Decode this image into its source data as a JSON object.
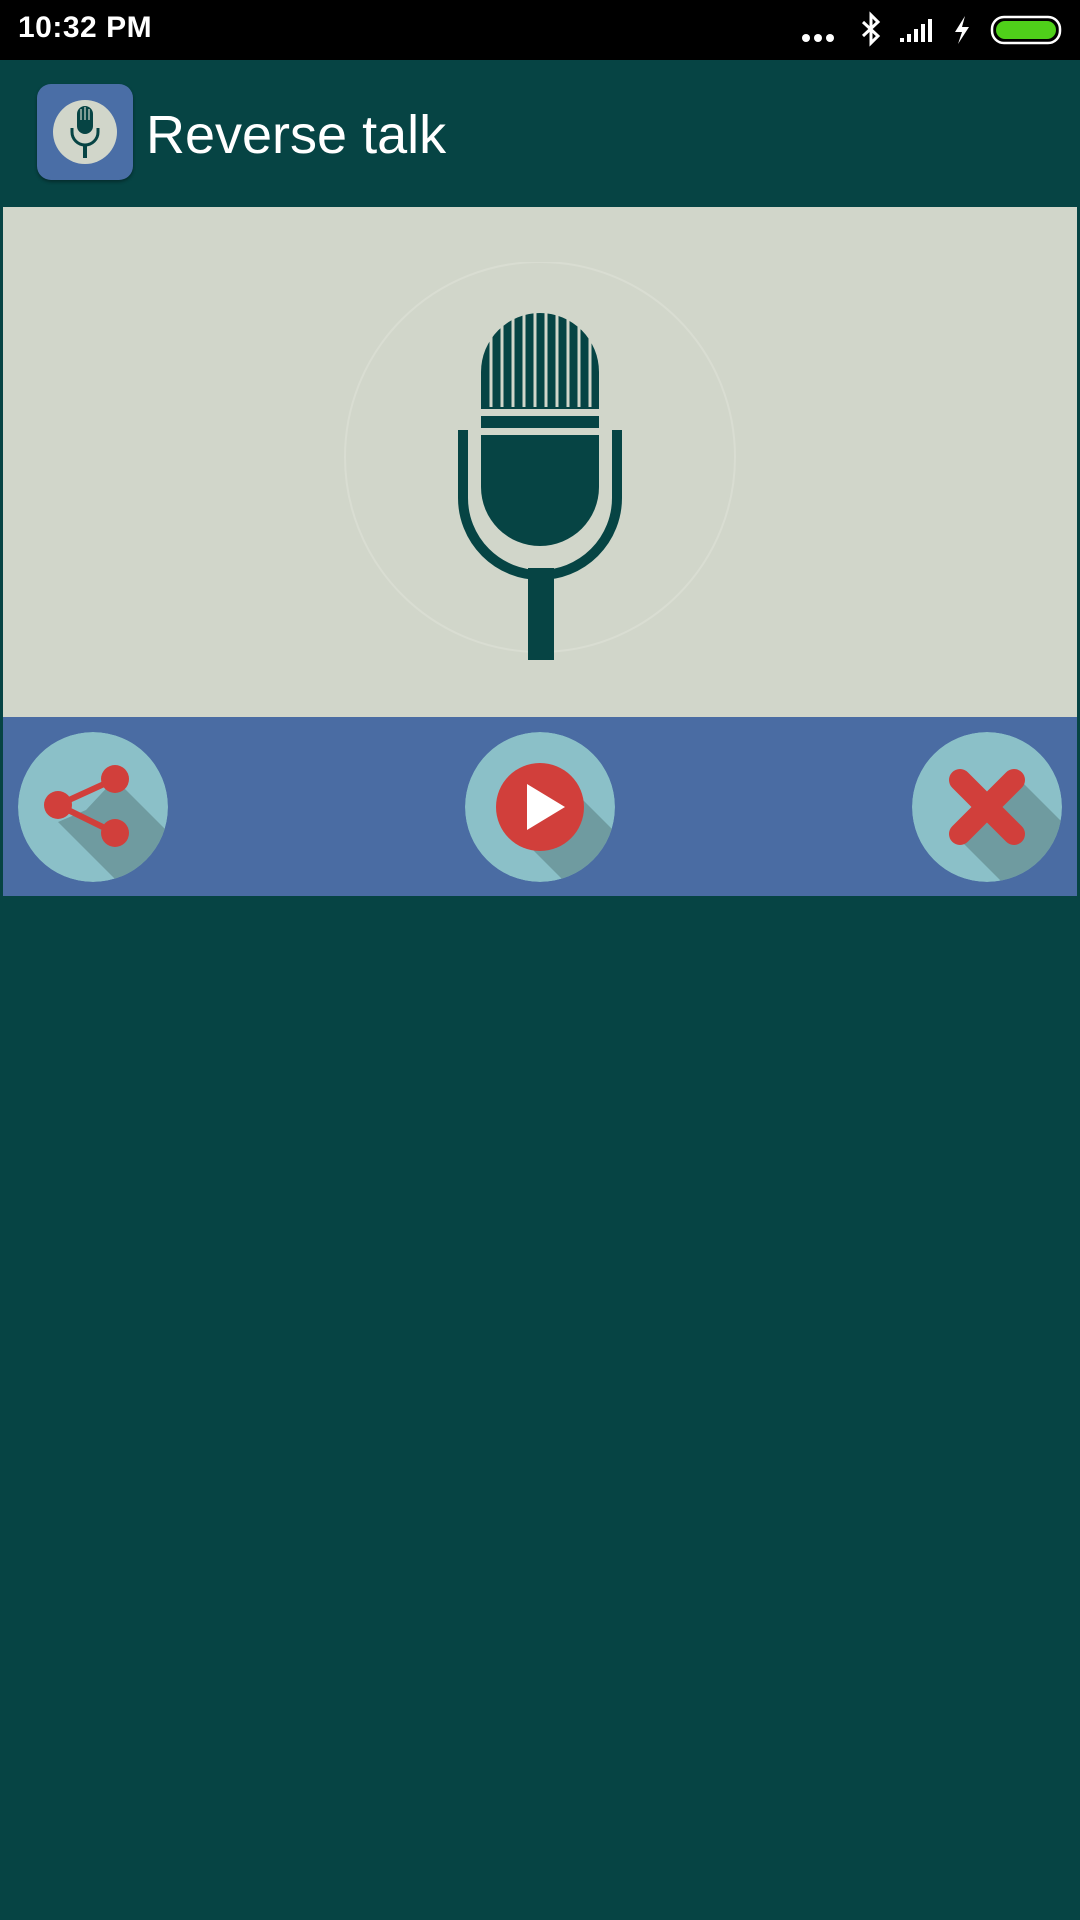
{
  "status_bar": {
    "time": "10:32 PM",
    "icons": [
      "more-dots-icon",
      "bluetooth-icon",
      "signal-icon",
      "charging-icon",
      "battery-icon"
    ]
  },
  "app_bar": {
    "title": "Reverse talk",
    "icon": "microphone-icon"
  },
  "main": {
    "record_icon": "microphone-icon"
  },
  "actions": {
    "buttons": [
      "share-icon",
      "play-icon",
      "close-icon"
    ]
  },
  "colors": {
    "background": "#064444",
    "panel": "#d1d6ca",
    "action_bar": "#4a6ca3",
    "button_circle": "#8bc0c8",
    "accent_red": "#d13f3b",
    "battery_green": "#4fd01a"
  }
}
